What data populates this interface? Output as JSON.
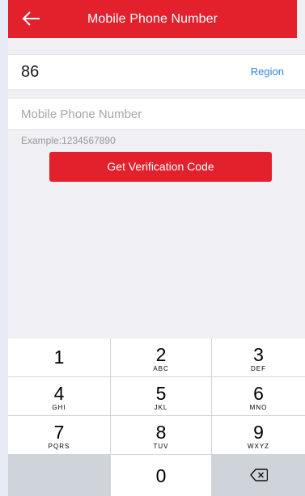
{
  "header": {
    "title": "Mobile Phone Number",
    "back_icon": "arrow-left-icon"
  },
  "region": {
    "country_code": "86",
    "region_label": "Region"
  },
  "phone": {
    "placeholder": "Mobile Phone Number",
    "value": "",
    "example": "Example:1234567890"
  },
  "verify_button": {
    "label": "Get Verification Code"
  },
  "keypad": {
    "keys": [
      {
        "digit": "1",
        "letters": ""
      },
      {
        "digit": "2",
        "letters": "ABC"
      },
      {
        "digit": "3",
        "letters": "DEF"
      },
      {
        "digit": "4",
        "letters": "GHI"
      },
      {
        "digit": "5",
        "letters": "JKL"
      },
      {
        "digit": "6",
        "letters": "MNO"
      },
      {
        "digit": "7",
        "letters": "PQRS"
      },
      {
        "digit": "8",
        "letters": "TUV"
      },
      {
        "digit": "9",
        "letters": "WXYZ"
      },
      {
        "digit": "0",
        "letters": ""
      }
    ],
    "delete_icon": "backspace-icon"
  },
  "colors": {
    "brand_red": "#e2212c",
    "link_blue": "#2e86d6",
    "background": "#efeff4"
  }
}
